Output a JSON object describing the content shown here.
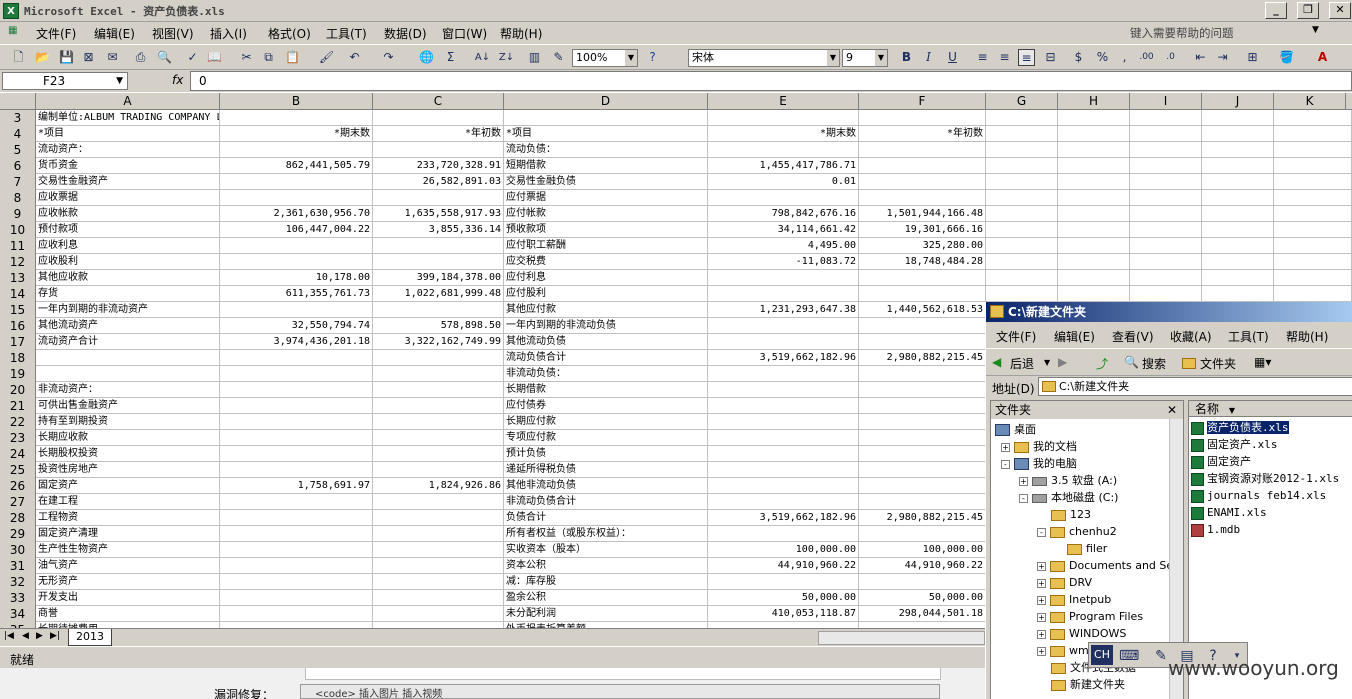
{
  "window": {
    "title": "Microsoft Excel - 资产负债表.xls",
    "icon": "excel-icon"
  },
  "menu": {
    "items": [
      "文件(F)",
      "编辑(E)",
      "视图(V)",
      "插入(I)",
      "格式(O)",
      "工具(T)",
      "数据(D)",
      "窗口(W)",
      "帮助(H)"
    ],
    "help_placeholder": "键入需要帮助的问题"
  },
  "toolbar": {
    "zoom": "100%",
    "font": "宋体",
    "font_size": "9"
  },
  "formula_bar": {
    "cell_ref": "F23",
    "fx": "fx",
    "value": "0"
  },
  "columns": [
    "A",
    "B",
    "C",
    "D",
    "E",
    "F",
    "G",
    "H",
    "I",
    "J",
    "K"
  ],
  "rows": [
    {
      "n": "3",
      "a": "编制单位:ALBUM TRADING COMPANY LIMITED",
      "b": "",
      "c": "",
      "d": "",
      "e": "",
      "f": ""
    },
    {
      "n": "4",
      "a": "*项目",
      "b": "*期末数",
      "c": "*年初数",
      "d": "*项目",
      "e": "*期末数",
      "f": "*年初数"
    },
    {
      "n": "5",
      "a": "流动资产：",
      "b": "",
      "c": "",
      "d": "流动负债：",
      "e": "",
      "f": ""
    },
    {
      "n": "6",
      "a": "  货币资金",
      "b": "862,441,505.79",
      "c": "233,720,328.91",
      "d": "  短期借款",
      "e": "1,455,417,786.71",
      "f": ""
    },
    {
      "n": "7",
      "a": "  交易性金融资产",
      "b": "",
      "c": "26,582,891.03",
      "d": "  交易性金融负债",
      "e": "0.01",
      "f": ""
    },
    {
      "n": "8",
      "a": "  应收票据",
      "b": "",
      "c": "",
      "d": "  应付票据",
      "e": "",
      "f": ""
    },
    {
      "n": "9",
      "a": "  应收帐款",
      "b": "2,361,630,956.70",
      "c": "1,635,558,917.93",
      "d": "  应付帐款",
      "e": "798,842,676.16",
      "f": "1,501,944,166.48"
    },
    {
      "n": "10",
      "a": "  预付款项",
      "b": "106,447,004.22",
      "c": "3,855,336.14",
      "d": "  预收款项",
      "e": "34,114,661.42",
      "f": "19,301,666.16"
    },
    {
      "n": "11",
      "a": "  应收利息",
      "b": "",
      "c": "",
      "d": "  应付职工薪酬",
      "e": "4,495.00",
      "f": "325,280.00"
    },
    {
      "n": "12",
      "a": "  应收股利",
      "b": "",
      "c": "",
      "d": "  应交税费",
      "e": "-11,083.72",
      "f": "18,748,484.28"
    },
    {
      "n": "13",
      "a": "  其他应收款",
      "b": "10,178.00",
      "c": "399,184,378.00",
      "d": "  应付利息",
      "e": "",
      "f": ""
    },
    {
      "n": "14",
      "a": "  存货",
      "b": "611,355,761.73",
      "c": "1,022,681,999.48",
      "d": "  应付股利",
      "e": "",
      "f": ""
    },
    {
      "n": "15",
      "a": "  一年内到期的非流动资产",
      "b": "",
      "c": "",
      "d": "  其他应付款",
      "e": "1,231,293,647.38",
      "f": "1,440,562,618.53"
    },
    {
      "n": "16",
      "a": "  其他流动资产",
      "b": "32,550,794.74",
      "c": "578,898.50",
      "d": "  一年内到期的非流动负债",
      "e": "",
      "f": ""
    },
    {
      "n": "17",
      "a": "流动资产合计",
      "b": "3,974,436,201.18",
      "c": "3,322,162,749.99",
      "d": "  其他流动负债",
      "e": "",
      "f": ""
    },
    {
      "n": "18",
      "a": "",
      "b": "",
      "c": "",
      "d": "流动负债合计",
      "e": "3,519,662,182.96",
      "f": "2,980,882,215.45"
    },
    {
      "n": "19",
      "a": "",
      "b": "",
      "c": "",
      "d": "非流动负债：",
      "e": "",
      "f": ""
    },
    {
      "n": "20",
      "a": "非流动资产：",
      "b": "",
      "c": "",
      "d": "  长期借款",
      "e": "",
      "f": ""
    },
    {
      "n": "21",
      "a": "  可供出售金融资产",
      "b": "",
      "c": "",
      "d": "  应付债券",
      "e": "",
      "f": ""
    },
    {
      "n": "22",
      "a": "  持有至到期投资",
      "b": "",
      "c": "",
      "d": "  长期应付款",
      "e": "",
      "f": ""
    },
    {
      "n": "23",
      "a": "  长期应收款",
      "b": "",
      "c": "",
      "d": "  专项应付款",
      "e": "",
      "f": ""
    },
    {
      "n": "24",
      "a": "  长期股权投资",
      "b": "",
      "c": "",
      "d": "  预计负债",
      "e": "",
      "f": ""
    },
    {
      "n": "25",
      "a": "  投资性房地产",
      "b": "",
      "c": "",
      "d": "  递延所得税负债",
      "e": "",
      "f": ""
    },
    {
      "n": "26",
      "a": "  固定资产",
      "b": "1,758,691.97",
      "c": "1,824,926.86",
      "d": "  其他非流动负债",
      "e": "",
      "f": ""
    },
    {
      "n": "27",
      "a": "  在建工程",
      "b": "",
      "c": "",
      "d": "非流动负债合计",
      "e": "",
      "f": ""
    },
    {
      "n": "28",
      "a": "  工程物资",
      "b": "",
      "c": "",
      "d": "负债合计",
      "e": "3,519,662,182.96",
      "f": "2,980,882,215.45"
    },
    {
      "n": "29",
      "a": "  固定资产清理",
      "b": "",
      "c": "",
      "d": "所有者权益（或股东权益）：",
      "e": "",
      "f": ""
    },
    {
      "n": "30",
      "a": "  生产性生物资产",
      "b": "",
      "c": "",
      "d": "  实收资本（股本）",
      "e": "100,000.00",
      "f": "100,000.00"
    },
    {
      "n": "31",
      "a": "  油气资产",
      "b": "",
      "c": "",
      "d": "  资本公积",
      "e": "44,910,960.22",
      "f": "44,910,960.22"
    },
    {
      "n": "32",
      "a": "  无形资产",
      "b": "",
      "c": "",
      "d": "  减：库存股",
      "e": "",
      "f": ""
    },
    {
      "n": "33",
      "a": "  开发支出",
      "b": "",
      "c": "",
      "d": "  盈余公积",
      "e": "50,000.00",
      "f": "50,000.00"
    },
    {
      "n": "34",
      "a": "  商誉",
      "b": "",
      "c": "",
      "d": "  未分配利润",
      "e": "410,053,118.87",
      "f": "298,044,501.18"
    },
    {
      "n": "35",
      "a": "  长期待摊费用",
      "b": "",
      "c": "",
      "d": "  外币报表折算差额",
      "e": "",
      "f": ""
    }
  ],
  "sheet_tab": "2013",
  "status": "就绪",
  "underlying_page": {
    "label": "漏洞修复：",
    "toolbar": "<code>  插入图片  插入视频"
  },
  "explorer": {
    "title": "C:\\新建文件夹",
    "menu": [
      "文件(F)",
      "编辑(E)",
      "查看(V)",
      "收藏(A)",
      "工具(T)",
      "帮助(H)"
    ],
    "back": "后退",
    "search": "搜索",
    "folders_btn": "文件夹",
    "address_label": "地址(D)",
    "address": "C:\\新建文件夹",
    "folders_header": "文件夹",
    "files_header": "名称",
    "tree": [
      {
        "label": "桌面",
        "icon": "desktop"
      },
      {
        "label": "我的文档",
        "icon": "folder"
      },
      {
        "label": "我的电脑",
        "icon": "computer"
      },
      {
        "label": "3.5 软盘 (A:)",
        "icon": "drive"
      },
      {
        "label": "本地磁盘 (C:)",
        "icon": "drive"
      },
      {
        "label": "123",
        "icon": "folder"
      },
      {
        "label": "chenhu2",
        "icon": "folder"
      },
      {
        "label": "filer",
        "icon": "folder"
      },
      {
        "label": "Documents and Se",
        "icon": "folder"
      },
      {
        "label": "DRV",
        "icon": "folder"
      },
      {
        "label": "Inetpub",
        "icon": "folder"
      },
      {
        "label": "Program Files",
        "icon": "folder"
      },
      {
        "label": "WINDOWS",
        "icon": "folder"
      },
      {
        "label": "wm",
        "icon": "folder"
      },
      {
        "label": "文件式主数据",
        "icon": "folder"
      },
      {
        "label": "新建文件夹",
        "icon": "folder"
      }
    ],
    "files": [
      {
        "name": "资产负债表.xls",
        "type": "xls",
        "selected": true
      },
      {
        "name": "固定资产.xls",
        "type": "xls",
        "selected": false
      },
      {
        "name": "固定资产",
        "type": "xls",
        "selected": false
      },
      {
        "name": "宝钢资源对账2012-1.xls",
        "type": "xls",
        "selected": false
      },
      {
        "name": "journals feb14.xls",
        "type": "xls",
        "selected": false
      },
      {
        "name": "ENAMI.xls",
        "type": "xls",
        "selected": false
      },
      {
        "name": "1.mdb",
        "type": "mdb",
        "selected": false
      }
    ]
  },
  "language_bar": {
    "label": "CH"
  },
  "watermark": "www.wooyun.org"
}
